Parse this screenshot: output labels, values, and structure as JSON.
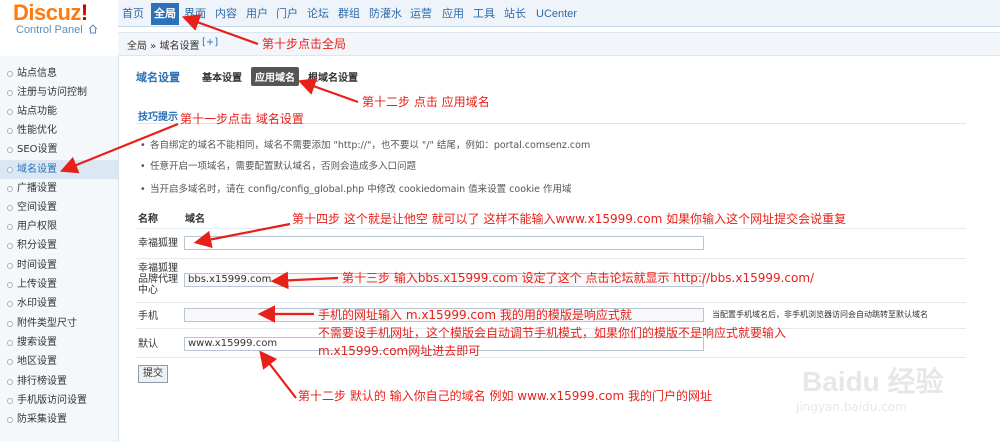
{
  "logo": {
    "brand": "Discuz",
    "brand_mark": "!",
    "subtitle": "Control Panel"
  },
  "topnav": [
    {
      "label": "首页"
    },
    {
      "label": "全局"
    },
    {
      "label": "界面"
    },
    {
      "label": "内容"
    },
    {
      "label": "用户"
    },
    {
      "label": "门户"
    },
    {
      "label": "论坛"
    },
    {
      "label": "群组"
    },
    {
      "label": "防灌水"
    },
    {
      "label": "运营"
    },
    {
      "label": "应用"
    },
    {
      "label": "工具"
    },
    {
      "label": "站长"
    },
    {
      "label": "UCenter"
    }
  ],
  "topnav_active": "全局",
  "breadcrumb": {
    "text": "全局 » 域名设置",
    "add": "[+]"
  },
  "sidebar": [
    {
      "label": "站点信息"
    },
    {
      "label": "注册与访问控制"
    },
    {
      "label": "站点功能"
    },
    {
      "label": "性能优化"
    },
    {
      "label": "SEO设置"
    },
    {
      "label": "域名设置"
    },
    {
      "label": "广播设置"
    },
    {
      "label": "空间设置"
    },
    {
      "label": "用户权限"
    },
    {
      "label": "积分设置"
    },
    {
      "label": "时间设置"
    },
    {
      "label": "上传设置"
    },
    {
      "label": "水印设置"
    },
    {
      "label": "附件类型尺寸"
    },
    {
      "label": "搜索设置"
    },
    {
      "label": "地区设置"
    },
    {
      "label": "排行榜设置"
    },
    {
      "label": "手机版访问设置"
    },
    {
      "label": "防采集设置"
    }
  ],
  "sidebar_active": "域名设置",
  "main": {
    "title": "域名设置",
    "subtabs": [
      {
        "label": "基本设置"
      },
      {
        "label": "应用域名"
      },
      {
        "label": "根域名设置"
      }
    ],
    "tips_title": "技巧提示",
    "tips": [
      "各自绑定的域名不能相同，域名不需要添加 \"http://\"，也不要以 \"/\" 结尾，例如：portal.comsenz.com",
      "任意开启一项域名，需要配置默认域名，否则会造成多入口问题",
      "当开启多域名时，请在 config/config_global.php 中修改 cookiedomain 值来设置 cookie 作用域"
    ],
    "col_name": "名称",
    "col_domain": "域名",
    "rows": [
      {
        "label": "幸福狐狸",
        "value": ""
      },
      {
        "label": "幸福狐狸品牌代理中心",
        "value": "bbs.x15999.com"
      },
      {
        "label": "手机",
        "value": ""
      },
      {
        "label": "默认",
        "value": "www.x15999.com"
      }
    ],
    "mobile_hint": "当配置手机域名后，非手机浏览器访问会自动跳转至默认域名",
    "submit": "提交"
  },
  "annotations": {
    "step10": "第十步点击全局",
    "step11": "第十一步点击 域名设置",
    "step12a": "第十二步 点击 应用域名",
    "step14": "第十四步 这个就是让他空 就可以了 这样不能输入www.x15999.com 如果你输入这个网址提交会说重复",
    "step13": "第十三步 输入bbs.x15999.com 设定了这个 点击论坛就显示 http://bbs.x15999.com/",
    "mobile1": "手机的网址输入 m.x15999.com 我的用的模版是响应式就",
    "mobile2": "不需要设手机网址，这个模版会自动调节手机模式，如果你们的模版不是响应式就要输入",
    "mobile3": "m.x15999.com网址进去即可",
    "step12b": "第十二步 默认的 输入你自己的域名 例如 www.x15999.com 我的门户的网址"
  },
  "watermark": {
    "brand": "Baidu 经验",
    "url": "jingyan.baidu.com"
  },
  "colors": {
    "accent": "#2b72b7",
    "annotation": "#e8201a",
    "brand": "#ff7a0e"
  }
}
